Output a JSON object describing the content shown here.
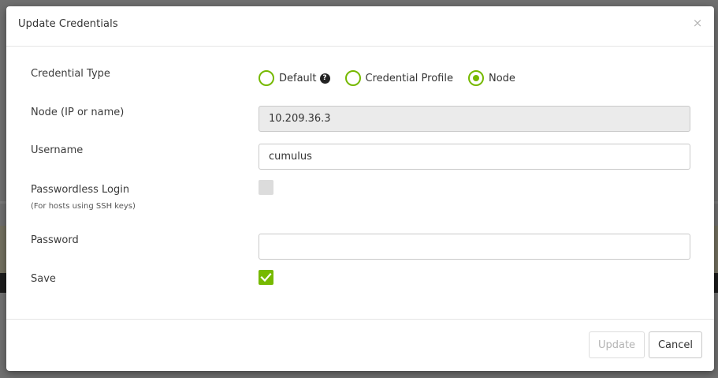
{
  "dialog": {
    "title": "Update Credentials",
    "close_glyph": "×"
  },
  "form": {
    "credential_type": {
      "label": "Credential Type",
      "options": [
        {
          "label": "Default",
          "checked": false,
          "has_help": true
        },
        {
          "label": "Credential Profile",
          "checked": false,
          "has_help": false
        },
        {
          "label": "Node",
          "checked": true,
          "has_help": false
        }
      ],
      "help_glyph": "?"
    },
    "node": {
      "label": "Node (IP or name)",
      "value": "10.209.36.3"
    },
    "username": {
      "label": "Username",
      "value": "cumulus"
    },
    "passwordless": {
      "label": "Passwordless Login",
      "sublabel": "(For hosts using SSH keys)",
      "checked": false
    },
    "password": {
      "label": "Password",
      "value": ""
    },
    "save": {
      "label": "Save",
      "checked": true
    }
  },
  "footer": {
    "update_label": "Update",
    "cancel_label": "Cancel"
  },
  "colors": {
    "accent": "#76b900",
    "overlay": "#6f6f6f"
  }
}
